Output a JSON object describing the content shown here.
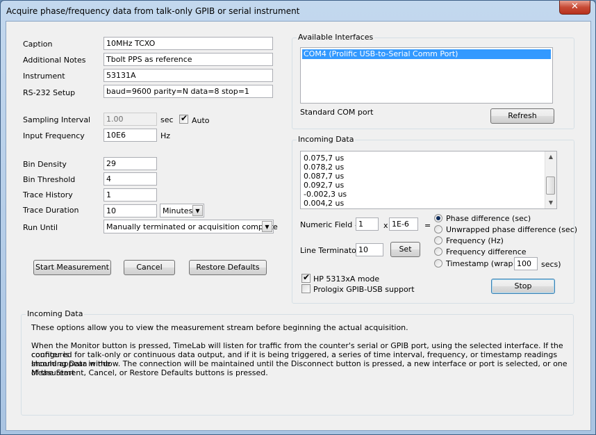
{
  "window": {
    "title": "Acquire phase/frequency data from talk-only GPIB or serial instrument",
    "close_label": "✕"
  },
  "settings": {
    "caption_label": "Caption",
    "caption_value": "10MHz TCXO",
    "notes_label": "Additional Notes",
    "notes_value": "Tbolt PPS as reference",
    "instrument_label": "Instrument",
    "instrument_value": "53131A",
    "rs232_label": "RS-232 Setup",
    "rs232_value": "baud=9600 parity=N data=8 stop=1",
    "sampling_label": "Sampling Interval",
    "sampling_value": "1.00",
    "sampling_unit": "sec",
    "auto_label": "Auto",
    "auto_checked": true,
    "input_freq_label": "Input Frequency",
    "input_freq_value": "10E6",
    "input_freq_unit": "Hz",
    "bin_density_label": "Bin Density",
    "bin_density_value": "29",
    "bin_threshold_label": "Bin Threshold",
    "bin_threshold_value": "4",
    "trace_history_label": "Trace History",
    "trace_history_value": "1",
    "trace_duration_label": "Trace Duration",
    "trace_duration_value": "10",
    "trace_duration_unit": "Minutes",
    "run_until_label": "Run Until",
    "run_until_value": "Manually terminated or acquisition complete"
  },
  "buttons": {
    "start": "Start Measurement",
    "cancel": "Cancel",
    "restore": "Restore Defaults"
  },
  "interfaces": {
    "group_title": "Available Interfaces",
    "items": [
      "COM4 (Prolific USB-to-Serial Comm Port)"
    ],
    "description": "Standard COM port",
    "refresh_label": "Refresh"
  },
  "incoming": {
    "group_title": "Incoming Data",
    "lines": [
      "0.075,7 us",
      "0.078,2 us",
      "0.087,7 us",
      "0.092,7 us",
      "-0.002,3 us",
      "0.004,2 us"
    ],
    "numeric_field_label": "Numeric Field #",
    "numeric_field_value": "1",
    "multiply_label": "x",
    "multiplier_value": "1E-6",
    "equals_label": "=",
    "line_terminator_label": "Line Terminator",
    "line_terminator_value": "10",
    "set_label": "Set",
    "radios": [
      "Phase difference (sec)",
      "Unwrapped phase difference (sec)",
      "Frequency (Hz)",
      "Frequency difference",
      "Timestamp (wrap at"
    ],
    "selected_radio": 0,
    "wrap_value": "100",
    "wrap_unit": "secs)",
    "hp_mode_label": "HP 5313xA mode",
    "hp_mode_checked": true,
    "prologix_label": "Prologix GPIB-USB support",
    "prologix_checked": false,
    "stop_label": "Stop"
  },
  "help": {
    "group_title": "Incoming Data",
    "para1": "These options allow you to view the measurement stream before beginning the actual acquisition.",
    "para2_lines": [
      "When the Monitor button is pressed, TimeLab will listen for traffic from the counter's serial or GPIB port, using the selected interface.  If the counter is",
      "configured for talk-only or continuous data output, and if it is being triggered, a series of time interval, frequency, or timestamp readings should appear in the",
      "Incoming Data window.  The connection will be maintained until the Disconnect button is pressed, a new interface or port is selected, or one of the Start",
      "Measurement, Cancel, or Restore Defaults buttons is pressed."
    ]
  }
}
